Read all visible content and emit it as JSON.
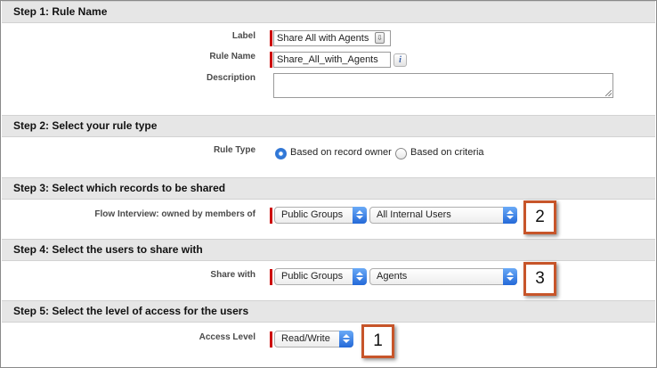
{
  "steps": [
    {
      "title": "Step 1: Rule Name"
    },
    {
      "title": "Step 2: Select your rule type"
    },
    {
      "title": "Step 3: Select which records to be shared"
    },
    {
      "title": "Step 4: Select the users to share with"
    },
    {
      "title": "Step 5: Select the level of access for the users"
    }
  ],
  "rule_name": {
    "label_label": "Label",
    "label_value": "Share All with Agents",
    "name_label": "Rule Name",
    "name_value": "Share_All_with_Agents",
    "info_icon": "i",
    "description_label": "Description",
    "description_value": ""
  },
  "rule_type": {
    "label": "Rule Type",
    "options": [
      {
        "label": "Based on record owner",
        "selected": true
      },
      {
        "label": "Based on criteria",
        "selected": false
      }
    ]
  },
  "records": {
    "label": "Flow Interview: owned by members of",
    "group_type": "Public Groups",
    "group": "All Internal Users"
  },
  "share_with": {
    "label": "Share with",
    "group_type": "Public Groups",
    "group": "Agents"
  },
  "access": {
    "label": "Access Level",
    "value": "Read/Write"
  },
  "callouts": [
    "1",
    "2",
    "3"
  ],
  "colors": {
    "required_bar": "#cc0000",
    "header_bg": "#e6e6e6",
    "select_arrow": "#2a6fdb",
    "callout_border": "#c7552a"
  },
  "icons": {
    "lookup": "lookup-icon",
    "info": "info-icon",
    "select_arrow": "select-arrows-icon",
    "resize": "resize-grip-icon"
  }
}
